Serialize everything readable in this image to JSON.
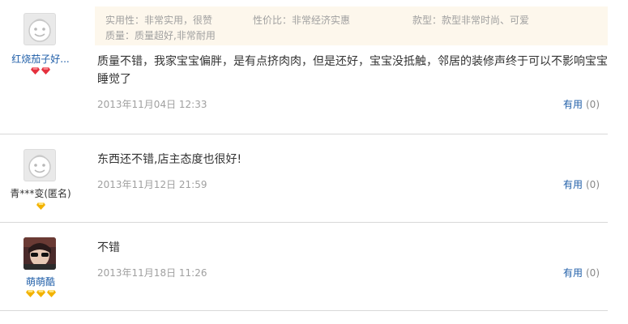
{
  "reviews": [
    {
      "user": {
        "name": "红烧茄子好...",
        "avatar": "default-avatar-icon",
        "badge_type": "diamond-icon",
        "badge_count": 2
      },
      "tags": {
        "practicality": "实用性：非常实用，很赞",
        "value": "性价比：非常经济实惠",
        "style": "款型：款型非常时尚、可爱",
        "quality": "质量：质量超好,非常耐用"
      },
      "content": "质量不错，我家宝宝偏胖，是有点挤肉肉，但是还好，宝宝没抵触，邻居的装修声终于可以不影响宝宝睡觉了",
      "date": "2013年11月04日 12:33",
      "useful_label": "有用",
      "useful_count": "(0)"
    },
    {
      "user": {
        "name": "青***变(匿名)",
        "avatar": "default-avatar-icon",
        "badge_type": "gold-diamond-icon",
        "badge_count": 1
      },
      "content": "东西还不错,店主态度也很好!",
      "date": "2013年11月12日 21:59",
      "useful_label": "有用",
      "useful_count": "(0)"
    },
    {
      "user": {
        "name": "萌萌酷",
        "avatar": "photo-avatar",
        "badge_type": "gold-diamond-icon",
        "badge_count": 3
      },
      "content": "不错",
      "date": "2013年11月18日 11:26",
      "useful_label": "有用",
      "useful_count": "(0)"
    }
  ],
  "colors": {
    "link": "#1f5ea8",
    "muted": "#a0a0a0",
    "tag_background": "#fdf7ec",
    "divider": "#d8d8d8",
    "diamond_red": "#e5303d",
    "diamond_gold": "#f2b200"
  }
}
